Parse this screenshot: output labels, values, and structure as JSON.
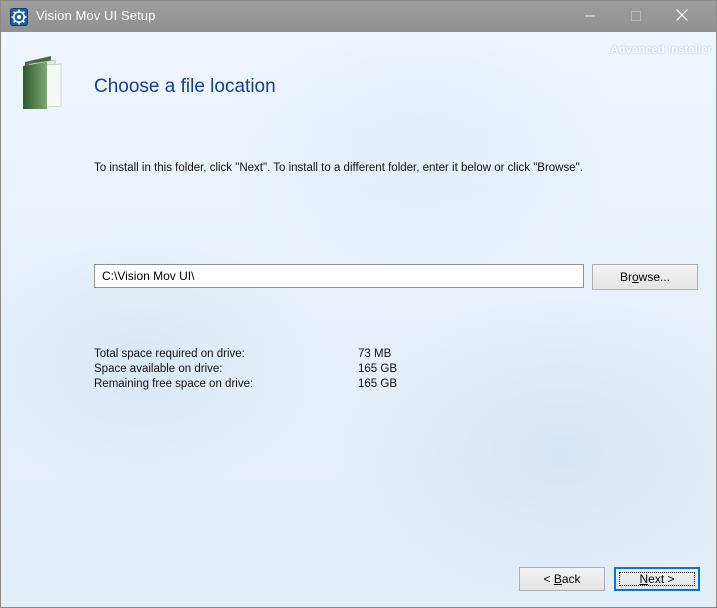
{
  "window": {
    "title": "Vision Mov UI Setup",
    "brand": "Advanced Installer"
  },
  "page": {
    "heading": "Choose a file location",
    "instruction": "To install in this folder, click \"Next\". To install to a different folder, enter it below or click \"Browse\"."
  },
  "location": {
    "path_value": "C:\\Vision Mov UI\\",
    "browse_label_pre": "Br",
    "browse_label_key": "o",
    "browse_label_post": "wse..."
  },
  "space": {
    "rows": [
      {
        "label": "Total space required on drive:",
        "value": "73 MB"
      },
      {
        "label": "Space available on drive:",
        "value": "165 GB"
      },
      {
        "label": "Remaining free space on drive:",
        "value": "165 GB"
      }
    ]
  },
  "buttons": {
    "back_prefix": "< ",
    "back_key": "B",
    "back_rest": "ack",
    "next_key": "N",
    "next_rest": "ext >"
  },
  "colors": {
    "heading": "#1a3f8e",
    "titlebar": "#989898",
    "focus_border": "#0078d7"
  },
  "icons": {
    "app": "setup-gear-icon",
    "folder": "folder-icon",
    "minimize": "minimize-icon",
    "maximize": "maximize-icon",
    "close": "close-icon"
  }
}
